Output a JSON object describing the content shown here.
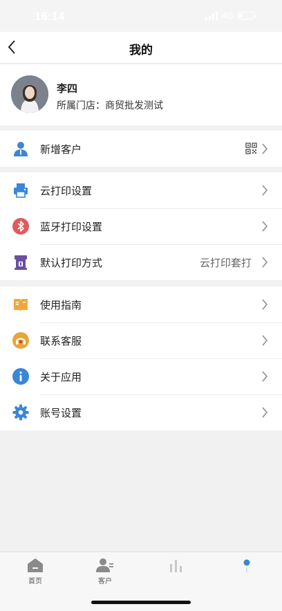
{
  "status_bar": {
    "time": "16:14",
    "network": "4G"
  },
  "nav": {
    "title": "我的"
  },
  "profile": {
    "name": "李四",
    "store": "所属门店：商贸批发测试"
  },
  "groups": [
    {
      "items": [
        {
          "label": "新增客户",
          "icon": "add-customer-icon",
          "value": "",
          "trailing": "qr-code-icon"
        }
      ]
    },
    {
      "items": [
        {
          "label": "云打印设置",
          "icon": "printer-icon",
          "value": ""
        },
        {
          "label": "蓝牙打印设置",
          "icon": "bluetooth-icon",
          "value": ""
        },
        {
          "label": "默认打印方式",
          "icon": "print-mode-icon",
          "value": "云打印套打"
        }
      ]
    },
    {
      "items": [
        {
          "label": "使用指南",
          "icon": "guide-book-icon",
          "value": ""
        },
        {
          "label": "联系客服",
          "icon": "headset-icon",
          "value": ""
        },
        {
          "label": "关于应用",
          "icon": "info-icon",
          "value": ""
        },
        {
          "label": "账号设置",
          "icon": "gear-icon",
          "value": ""
        }
      ]
    }
  ],
  "tabs": [
    {
      "label": "首页",
      "icon": "home-icon"
    },
    {
      "label": "客户",
      "icon": "customer-icon"
    },
    {
      "label": "",
      "icon": "bar-chart-icon"
    },
    {
      "label": "",
      "icon": "profile-dot-icon",
      "active": true
    }
  ],
  "colors": {
    "accent": "#3a86d8",
    "bluetooth": "#e15a5a",
    "print_mode": "#6a4fa3",
    "guide": "#f1a83a",
    "service": "#e8a53a"
  }
}
